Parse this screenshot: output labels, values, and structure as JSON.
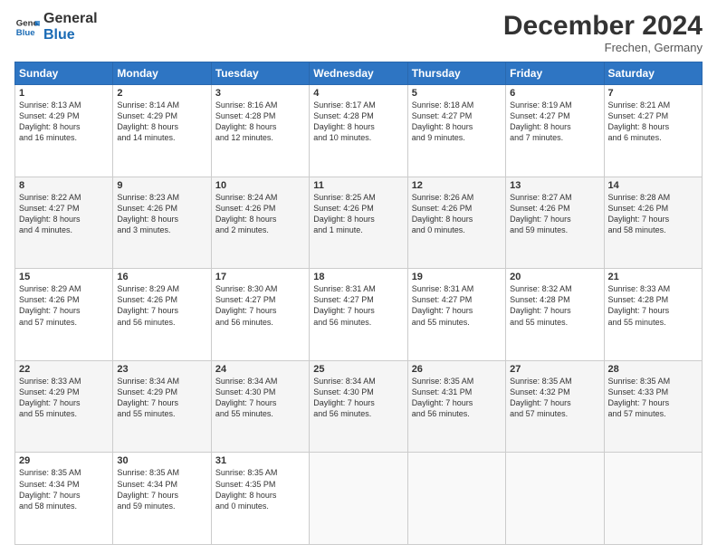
{
  "logo": {
    "line1": "General",
    "line2": "Blue"
  },
  "title": "December 2024",
  "subtitle": "Frechen, Germany",
  "days_header": [
    "Sunday",
    "Monday",
    "Tuesday",
    "Wednesday",
    "Thursday",
    "Friday",
    "Saturday"
  ],
  "weeks": [
    [
      {
        "num": "1",
        "info": "Sunrise: 8:13 AM\nSunset: 4:29 PM\nDaylight: 8 hours\nand 16 minutes."
      },
      {
        "num": "2",
        "info": "Sunrise: 8:14 AM\nSunset: 4:29 PM\nDaylight: 8 hours\nand 14 minutes."
      },
      {
        "num": "3",
        "info": "Sunrise: 8:16 AM\nSunset: 4:28 PM\nDaylight: 8 hours\nand 12 minutes."
      },
      {
        "num": "4",
        "info": "Sunrise: 8:17 AM\nSunset: 4:28 PM\nDaylight: 8 hours\nand 10 minutes."
      },
      {
        "num": "5",
        "info": "Sunrise: 8:18 AM\nSunset: 4:27 PM\nDaylight: 8 hours\nand 9 minutes."
      },
      {
        "num": "6",
        "info": "Sunrise: 8:19 AM\nSunset: 4:27 PM\nDaylight: 8 hours\nand 7 minutes."
      },
      {
        "num": "7",
        "info": "Sunrise: 8:21 AM\nSunset: 4:27 PM\nDaylight: 8 hours\nand 6 minutes."
      }
    ],
    [
      {
        "num": "8",
        "info": "Sunrise: 8:22 AM\nSunset: 4:27 PM\nDaylight: 8 hours\nand 4 minutes."
      },
      {
        "num": "9",
        "info": "Sunrise: 8:23 AM\nSunset: 4:26 PM\nDaylight: 8 hours\nand 3 minutes."
      },
      {
        "num": "10",
        "info": "Sunrise: 8:24 AM\nSunset: 4:26 PM\nDaylight: 8 hours\nand 2 minutes."
      },
      {
        "num": "11",
        "info": "Sunrise: 8:25 AM\nSunset: 4:26 PM\nDaylight: 8 hours\nand 1 minute."
      },
      {
        "num": "12",
        "info": "Sunrise: 8:26 AM\nSunset: 4:26 PM\nDaylight: 8 hours\nand 0 minutes."
      },
      {
        "num": "13",
        "info": "Sunrise: 8:27 AM\nSunset: 4:26 PM\nDaylight: 7 hours\nand 59 minutes."
      },
      {
        "num": "14",
        "info": "Sunrise: 8:28 AM\nSunset: 4:26 PM\nDaylight: 7 hours\nand 58 minutes."
      }
    ],
    [
      {
        "num": "15",
        "info": "Sunrise: 8:29 AM\nSunset: 4:26 PM\nDaylight: 7 hours\nand 57 minutes."
      },
      {
        "num": "16",
        "info": "Sunrise: 8:29 AM\nSunset: 4:26 PM\nDaylight: 7 hours\nand 56 minutes."
      },
      {
        "num": "17",
        "info": "Sunrise: 8:30 AM\nSunset: 4:27 PM\nDaylight: 7 hours\nand 56 minutes."
      },
      {
        "num": "18",
        "info": "Sunrise: 8:31 AM\nSunset: 4:27 PM\nDaylight: 7 hours\nand 56 minutes."
      },
      {
        "num": "19",
        "info": "Sunrise: 8:31 AM\nSunset: 4:27 PM\nDaylight: 7 hours\nand 55 minutes."
      },
      {
        "num": "20",
        "info": "Sunrise: 8:32 AM\nSunset: 4:28 PM\nDaylight: 7 hours\nand 55 minutes."
      },
      {
        "num": "21",
        "info": "Sunrise: 8:33 AM\nSunset: 4:28 PM\nDaylight: 7 hours\nand 55 minutes."
      }
    ],
    [
      {
        "num": "22",
        "info": "Sunrise: 8:33 AM\nSunset: 4:29 PM\nDaylight: 7 hours\nand 55 minutes."
      },
      {
        "num": "23",
        "info": "Sunrise: 8:34 AM\nSunset: 4:29 PM\nDaylight: 7 hours\nand 55 minutes."
      },
      {
        "num": "24",
        "info": "Sunrise: 8:34 AM\nSunset: 4:30 PM\nDaylight: 7 hours\nand 55 minutes."
      },
      {
        "num": "25",
        "info": "Sunrise: 8:34 AM\nSunset: 4:30 PM\nDaylight: 7 hours\nand 56 minutes."
      },
      {
        "num": "26",
        "info": "Sunrise: 8:35 AM\nSunset: 4:31 PM\nDaylight: 7 hours\nand 56 minutes."
      },
      {
        "num": "27",
        "info": "Sunrise: 8:35 AM\nSunset: 4:32 PM\nDaylight: 7 hours\nand 57 minutes."
      },
      {
        "num": "28",
        "info": "Sunrise: 8:35 AM\nSunset: 4:33 PM\nDaylight: 7 hours\nand 57 minutes."
      }
    ],
    [
      {
        "num": "29",
        "info": "Sunrise: 8:35 AM\nSunset: 4:34 PM\nDaylight: 7 hours\nand 58 minutes."
      },
      {
        "num": "30",
        "info": "Sunrise: 8:35 AM\nSunset: 4:34 PM\nDaylight: 7 hours\nand 59 minutes."
      },
      {
        "num": "31",
        "info": "Sunrise: 8:35 AM\nSunset: 4:35 PM\nDaylight: 8 hours\nand 0 minutes."
      },
      null,
      null,
      null,
      null
    ]
  ]
}
